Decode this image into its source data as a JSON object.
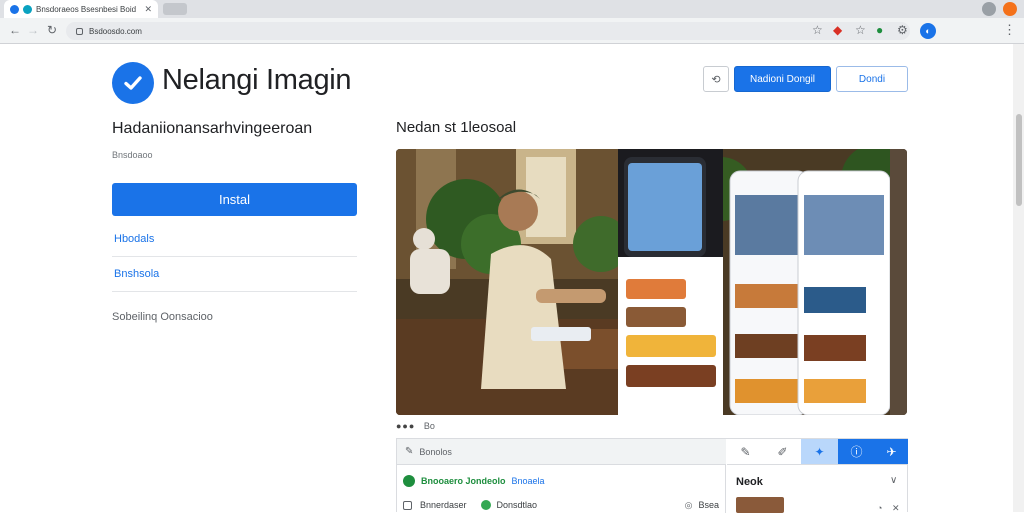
{
  "browser": {
    "tab_title": "Bnsdoraeos Bsesnbesi Boid",
    "address": "Bsdoosdo.com",
    "colors": {
      "accent": "#1a73e8",
      "chrome": "#dfe1e5"
    }
  },
  "app": {
    "title": "Nelangi Imagin",
    "logo_icon": "checkmark-circle-icon"
  },
  "header_actions": {
    "share_icon": "share-icon",
    "primary_label": "Nadioni Dongil",
    "secondary_label": "Dondi"
  },
  "sidebar": {
    "subtitle": "Hadaniionansarhvingeeroan",
    "meta": "Bnsdoaoo",
    "install_label": "Instal",
    "link1": "Hbodals",
    "link2": "Bnshsola",
    "plain": "Sobeilinq Oonsacioo"
  },
  "main": {
    "section_title": "Nedan st 1leosoal",
    "caption_dots": "●●●",
    "caption_text": "Bo"
  },
  "panel": {
    "header_label": "Bonolos",
    "row1_label": "Bnooaero Jondeolo",
    "row1_tag": "Bnoaela",
    "row2_label": "Bnnerdaser",
    "row2_tag": "Donsdtlao",
    "row2_right": "Bsea",
    "right_label": "Neok"
  }
}
